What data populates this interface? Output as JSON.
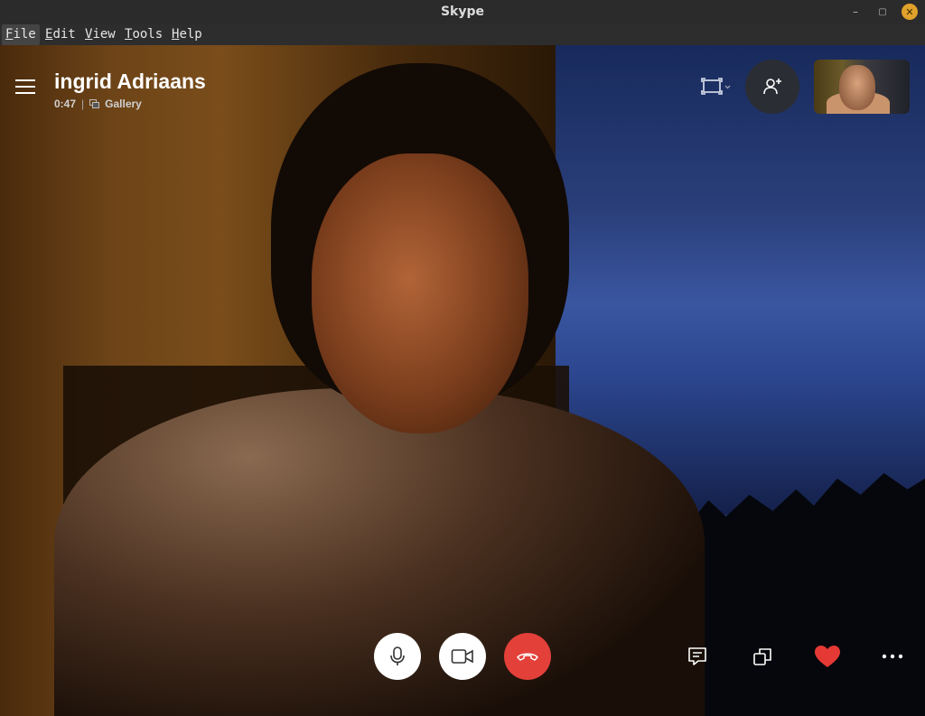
{
  "window": {
    "title": "Skype",
    "minimize": "–",
    "maximize": "▢",
    "close": "✕"
  },
  "menu": [
    {
      "label": "File",
      "mnemonic": "F",
      "rest": "ile"
    },
    {
      "label": "Edit",
      "mnemonic": "E",
      "rest": "dit"
    },
    {
      "label": "View",
      "mnemonic": "V",
      "rest": "iew"
    },
    {
      "label": "Tools",
      "mnemonic": "T",
      "rest": "ools"
    },
    {
      "label": "Help",
      "mnemonic": "H",
      "rest": "elp"
    }
  ],
  "call": {
    "caller_name": "ingrid Adriaans",
    "duration": "0:47",
    "separator": "|",
    "view_mode": "Gallery"
  },
  "icons": {
    "menu": "hamburger-icon",
    "screen": "screen-layout-icon",
    "add_people": "add-person-icon",
    "mic": "microphone-icon",
    "camera": "video-camera-icon",
    "end_call": "hang-up-icon",
    "chat": "chat-icon",
    "share": "share-screen-icon",
    "react": "heart-icon",
    "more": "more-options-icon"
  },
  "colors": {
    "end_call": "#e3403a",
    "heart": "#e53935",
    "control_bg": "#ffffff",
    "add_people_bg": "#2a2d34"
  }
}
